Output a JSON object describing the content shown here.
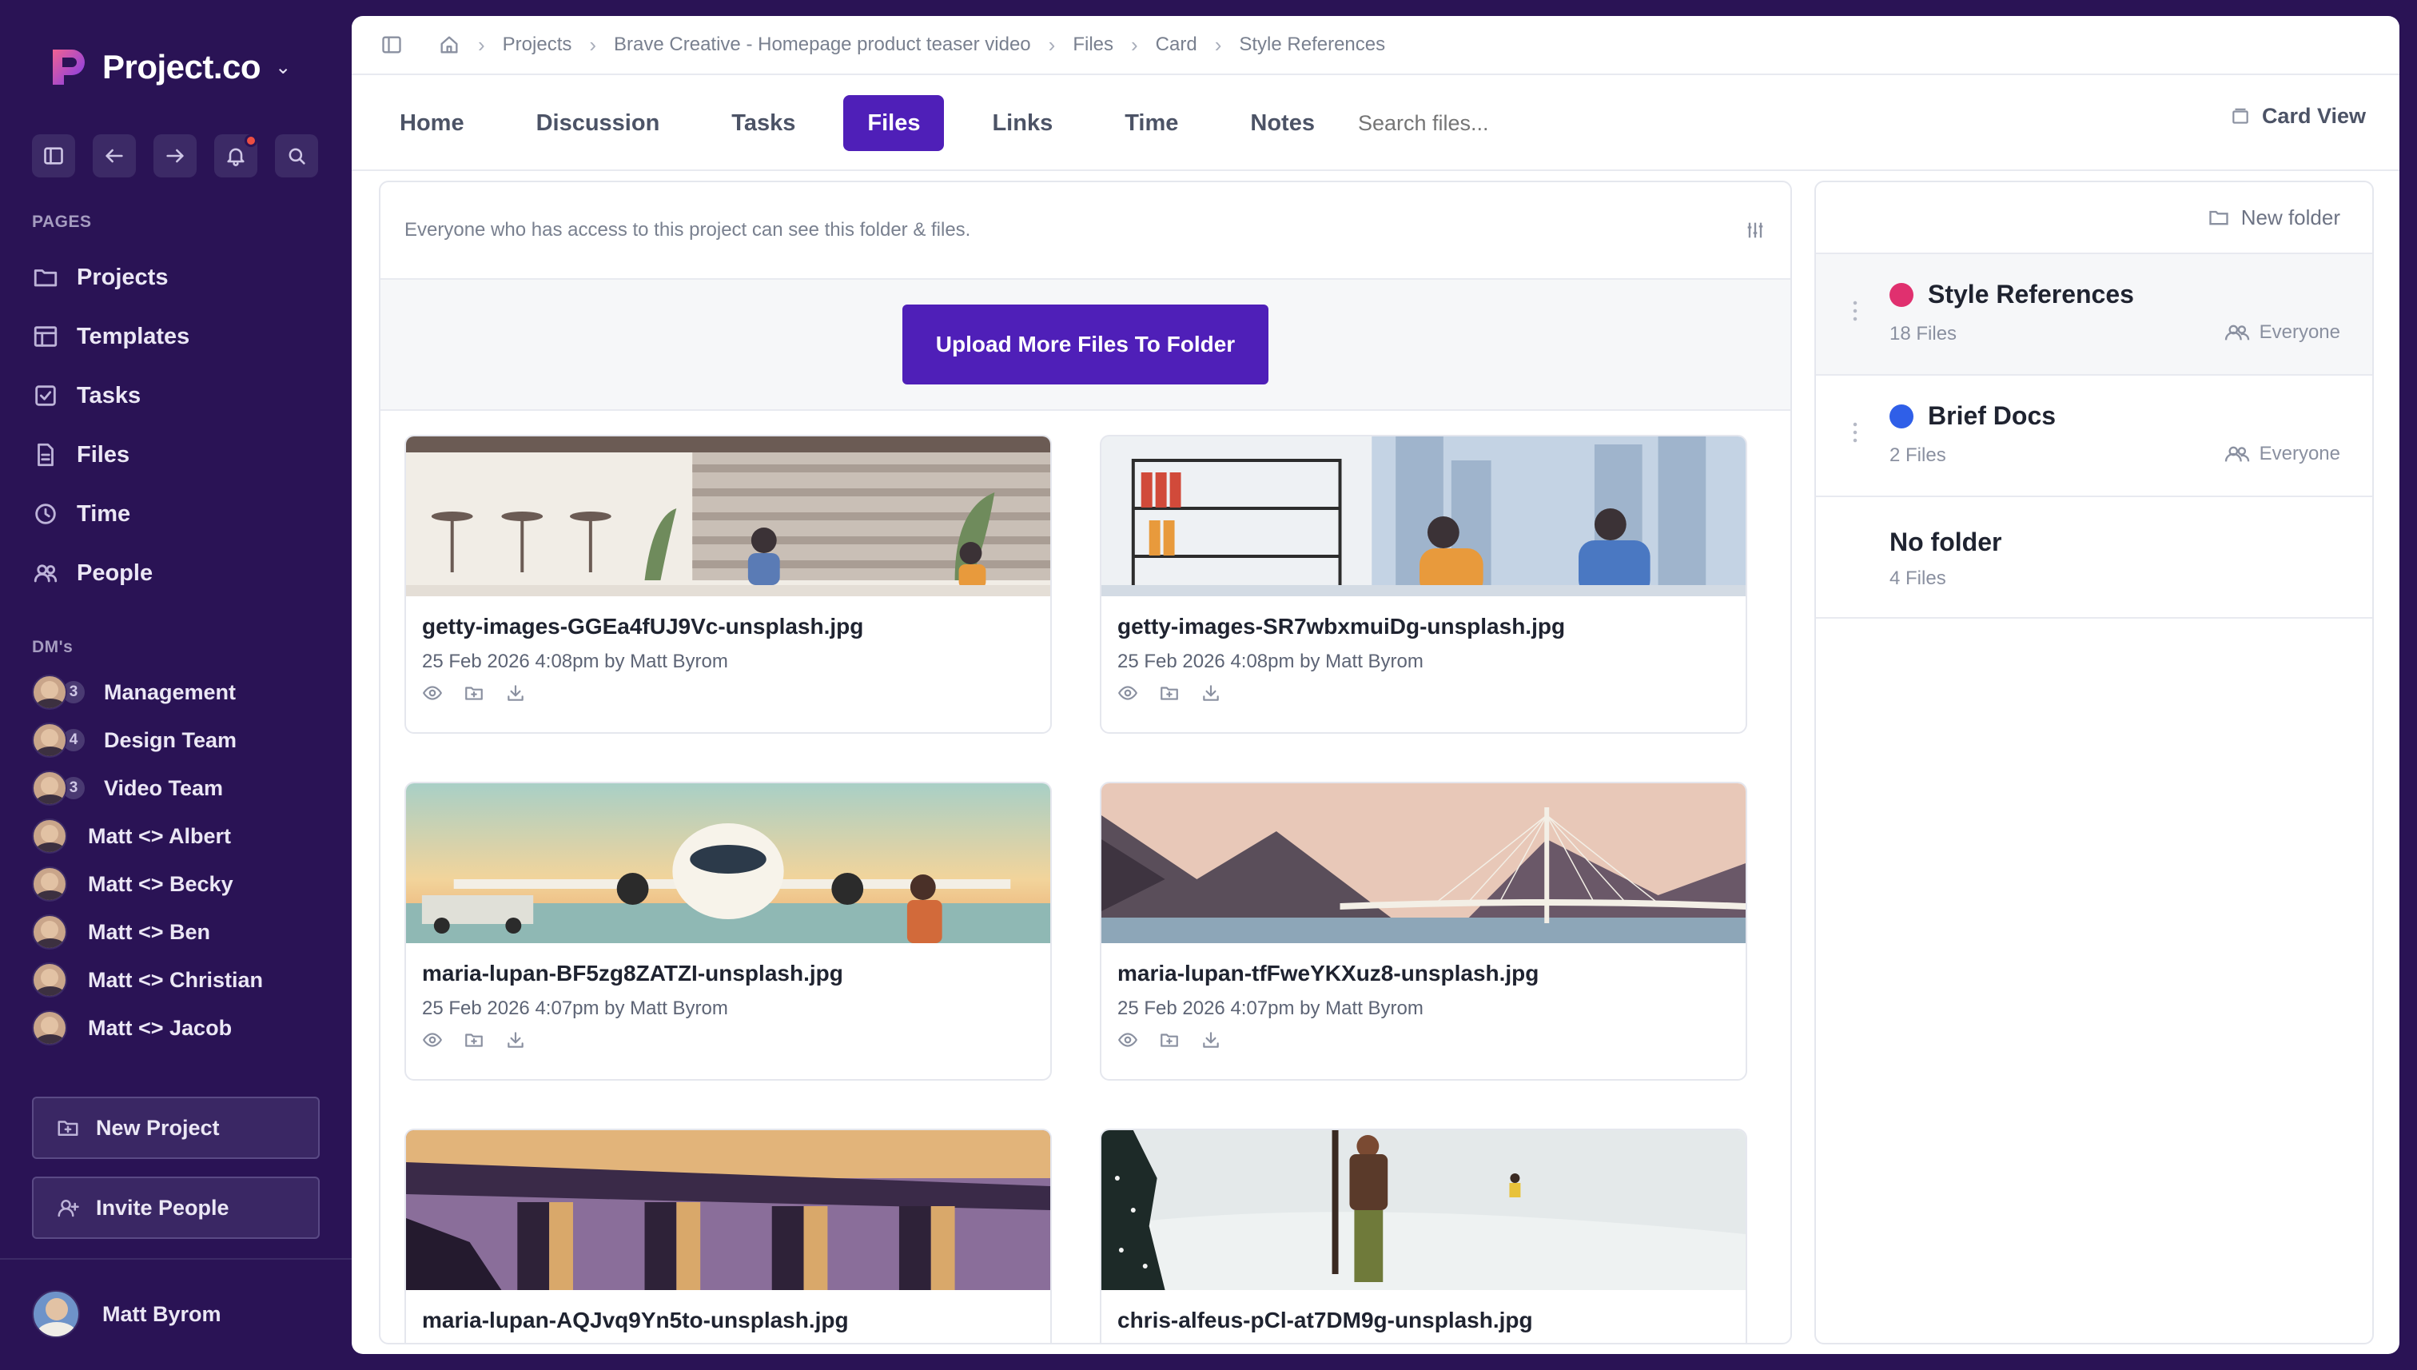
{
  "app": {
    "name": "Project.co",
    "brand_color": "#4f1fb8",
    "sidebar_color": "#2a1355"
  },
  "sidebar": {
    "pages_label": "PAGES",
    "pages": [
      {
        "label": "Projects",
        "icon": "folder-icon"
      },
      {
        "label": "Templates",
        "icon": "template-icon"
      },
      {
        "label": "Tasks",
        "icon": "checkbox-icon"
      },
      {
        "label": "Files",
        "icon": "file-icon"
      },
      {
        "label": "Time",
        "icon": "clock-icon"
      },
      {
        "label": "People",
        "icon": "people-icon"
      }
    ],
    "dms_label": "DM's",
    "dms": [
      {
        "label": "Management",
        "count": "3"
      },
      {
        "label": "Design Team",
        "count": "4"
      },
      {
        "label": "Video Team",
        "count": "3"
      },
      {
        "label": "Matt <> Albert"
      },
      {
        "label": "Matt <> Becky"
      },
      {
        "label": "Matt <> Ben"
      },
      {
        "label": "Matt <> Christian"
      },
      {
        "label": "Matt <> Jacob"
      }
    ],
    "new_project": "New Project",
    "invite_people": "Invite People",
    "user_name": "Matt Byrom"
  },
  "breadcrumb": [
    "Projects",
    "Brave Creative - Homepage product teaser video",
    "Files",
    "Card",
    "Style References"
  ],
  "tabs": [
    {
      "label": "Home"
    },
    {
      "label": "Discussion"
    },
    {
      "label": "Tasks"
    },
    {
      "label": "Files",
      "active": true
    },
    {
      "label": "Links"
    },
    {
      "label": "Time"
    },
    {
      "label": "Notes"
    }
  ],
  "search": {
    "placeholder": "Search files..."
  },
  "view_toggle": "Card View",
  "files": {
    "access_note": "Everyone who has access to this project can see this folder & files.",
    "upload_label": "Upload More Files To Folder",
    "items": [
      {
        "name": "getty-images-GGEa4fUJ9Vc-unsplash.jpg",
        "meta": "25 Feb 2026 4:08pm by Matt Byrom"
      },
      {
        "name": "getty-images-SR7wbxmuiDg-unsplash.jpg",
        "meta": "25 Feb 2026 4:08pm by Matt Byrom"
      },
      {
        "name": "maria-lupan-BF5zg8ZATZI-unsplash.jpg",
        "meta": "25 Feb 2026 4:07pm by Matt Byrom"
      },
      {
        "name": "maria-lupan-tfFweYKXuz8-unsplash.jpg",
        "meta": "25 Feb 2026 4:07pm by Matt Byrom"
      },
      {
        "name": "maria-lupan-AQJvq9Yn5to-unsplash.jpg",
        "meta": ""
      },
      {
        "name": "chris-alfeus-pCl-at7DM9g-unsplash.jpg",
        "meta": ""
      }
    ]
  },
  "folders": {
    "new_folder": "New folder",
    "items": [
      {
        "title": "Style References",
        "count": "18 Files",
        "access": "Everyone",
        "color": "#e0306f"
      },
      {
        "title": "Brief Docs",
        "count": "2 Files",
        "access": "Everyone",
        "color": "#2f5fe8"
      },
      {
        "title": "No folder",
        "count": "4 Files"
      }
    ]
  }
}
